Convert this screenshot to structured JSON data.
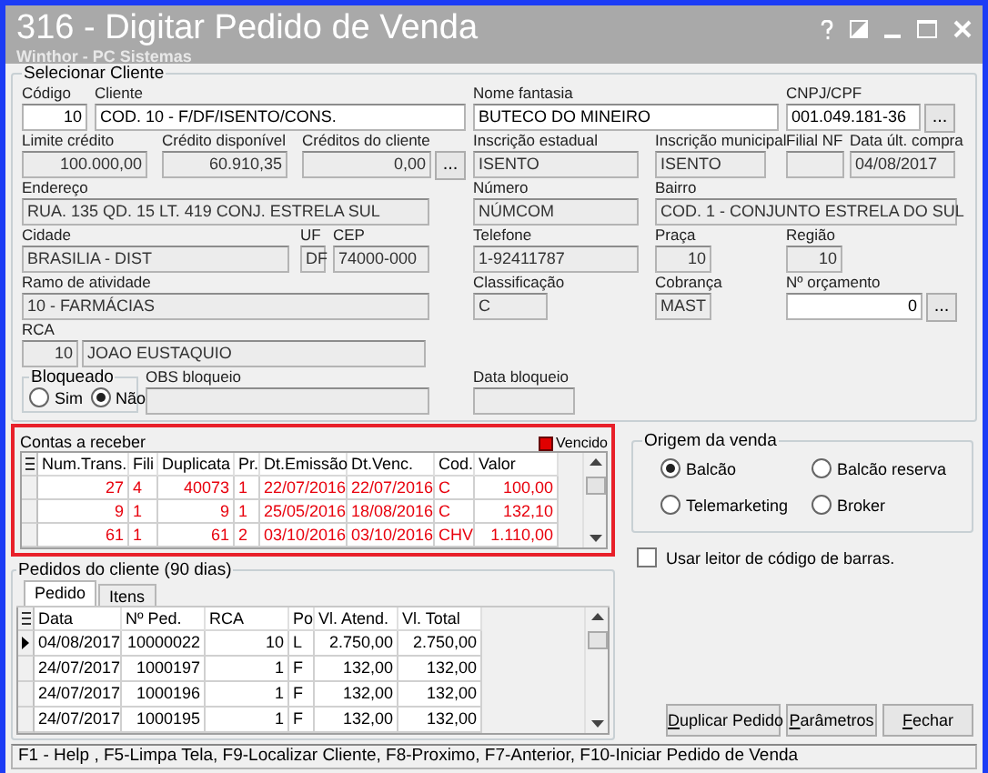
{
  "window": {
    "title": "316 - Digitar Pedido de Venda",
    "subtitle": "Winthor - PC Sistemas"
  },
  "client_group": {
    "title": "Selecionar Cliente",
    "rows": [
      [
        {
          "kind": "input",
          "label": "Código",
          "value": "10",
          "numeric": true,
          "editable": true
        },
        {
          "kind": "input",
          "label": "Cliente",
          "value": "COD. 10 - F/DF/ISENTO/CONS.",
          "editable": true
        },
        {
          "kind": "input",
          "label": "Nome fantasia",
          "value": "BUTECO DO MINEIRO",
          "editable": true
        },
        {
          "kind": "input",
          "label": "CNPJ/CPF",
          "value": "001.049.181-36",
          "editable": true,
          "button": "..."
        }
      ],
      [
        {
          "kind": "input",
          "label": "Limite crédito",
          "value": "100.000,00",
          "numeric": true,
          "editable": false
        },
        {
          "kind": "input",
          "label": "Crédito disponível",
          "value": "60.910,35",
          "numeric": true,
          "editable": false
        },
        {
          "kind": "input",
          "label": "Créditos do cliente",
          "value": "0,00",
          "numeric": true,
          "editable": false,
          "button": "..."
        },
        {
          "kind": "input",
          "label": "Inscrição estadual",
          "value": "ISENTO",
          "editable": false
        },
        {
          "kind": "input",
          "label": "Inscrição municipal",
          "value": "ISENTO",
          "editable": false
        },
        {
          "kind": "input",
          "label": "Filial NF",
          "editable": false
        },
        {
          "kind": "input",
          "label": "Data últ. compra",
          "value": "04/08/2017",
          "editable": false
        }
      ],
      [
        {
          "kind": "input",
          "label": "Endereço",
          "value": "RUA. 135 QD. 15 LT. 419 CONJ. ESTRELA SUL",
          "editable": false
        },
        {
          "kind": "input",
          "label": "Número",
          "value": "NÚMCOM",
          "editable": false
        },
        {
          "kind": "input",
          "label": "Bairro",
          "value": "COD. 1 - CONJUNTO ESTRELA DO SUL",
          "editable": false
        }
      ],
      [
        {
          "kind": "input",
          "label": "Cidade",
          "value": "BRASILIA - DIST",
          "editable": false
        },
        {
          "kind": "input",
          "label": "UF",
          "value": "DF",
          "editable": false
        },
        {
          "kind": "input",
          "label": "CEP",
          "value": "74000-000",
          "editable": false
        },
        {
          "kind": "input",
          "label": "Telefone",
          "value": "1-92411787",
          "editable": false
        },
        {
          "kind": "input",
          "label": "Praça",
          "value": "10",
          "numeric": true,
          "editable": false
        },
        {
          "kind": "input",
          "label": "Região",
          "value": "10",
          "numeric": true,
          "editable": false
        }
      ],
      [
        {
          "kind": "input",
          "label": "Ramo de atividade",
          "value": "10 - FARMÁCIAS",
          "editable": false
        },
        {
          "kind": "input",
          "label": "Classificação",
          "value": "C",
          "editable": false
        },
        {
          "kind": "input",
          "label": "Cobrança",
          "value": "MAST",
          "editable": false
        },
        {
          "kind": "input",
          "label": "Nº orçamento",
          "value": "0",
          "numeric": true,
          "editable": true,
          "button": "..."
        }
      ],
      [
        {
          "kind": "input",
          "label": "RCA",
          "value": "10",
          "numeric": true,
          "editable": false,
          "description": "JOAO EUSTAQUIO"
        }
      ],
      [
        {
          "kind": "radios",
          "label": "Bloqueado",
          "options": [
            {
              "label": "Sim",
              "selected": false
            },
            {
              "label": "Não",
              "selected": true
            }
          ]
        },
        {
          "kind": "input",
          "label": "OBS bloqueio",
          "editable": false
        },
        {
          "kind": "input",
          "label": "Data bloqueio",
          "editable": false
        }
      ]
    ]
  },
  "receivables": {
    "title": "Contas a receber",
    "legend": "Vencido",
    "columns": [
      "Num.Trans.",
      "Fili",
      "Duplicata",
      "Pr.",
      "Dt.Emissão",
      "Dt.Venc.",
      "Cod.",
      "Valor"
    ],
    "rows": [
      {
        "overdue": true,
        "cells": [
          "27",
          "4",
          "40073",
          "1",
          "22/07/2016",
          "22/07/2016",
          "C",
          "100,00"
        ]
      },
      {
        "overdue": true,
        "cells": [
          "9",
          "1",
          "9",
          "1",
          "25/05/2016",
          "18/08/2016",
          "C",
          "132,10"
        ]
      },
      {
        "overdue": true,
        "cells": [
          "61",
          "1",
          "61",
          "2",
          "03/10/2016",
          "03/10/2016",
          "CHV",
          "1.110,00"
        ]
      }
    ]
  },
  "sale_origin": {
    "title": "Origem da venda",
    "options": [
      {
        "label": "Balcão",
        "selected": true
      },
      {
        "label": "Balcão reserva",
        "selected": false
      },
      {
        "label": "Telemarketing",
        "selected": false
      },
      {
        "label": "Broker",
        "selected": false
      }
    ]
  },
  "barcode_reader": {
    "label": "Usar leitor de código de barras.",
    "checked": false
  },
  "orders": {
    "title": "Pedidos do cliente (90 dias)",
    "tabs": [
      {
        "label": "Pedido",
        "selected": true
      },
      {
        "label": "Itens",
        "selected": false
      }
    ],
    "columns": [
      "Data",
      "Nº Ped.",
      "RCA",
      "Po",
      "Vl. Atend.",
      "Vl. Total"
    ],
    "rows": [
      {
        "selected": true,
        "cells": [
          "04/08/2017",
          "10000022",
          "10",
          "L",
          "2.750,00",
          "2.750,00"
        ]
      },
      {
        "selected": false,
        "cells": [
          "24/07/2017",
          "1000197",
          "1",
          "F",
          "132,00",
          "132,00"
        ]
      },
      {
        "selected": false,
        "cells": [
          "24/07/2017",
          "1000196",
          "1",
          "F",
          "132,00",
          "132,00"
        ]
      },
      {
        "selected": false,
        "cells": [
          "24/07/2017",
          "1000195",
          "1",
          "F",
          "132,00",
          "132,00"
        ]
      }
    ]
  },
  "buttons": [
    "Duplicar Pedido",
    "Parâmetros",
    "Fechar"
  ],
  "status_bar": "F1 - Help , F5-Limpa Tela, F9-Localizar Cliente, F8-Proximo, F7-Anterior, F10-Iniciar Pedido de Venda"
}
